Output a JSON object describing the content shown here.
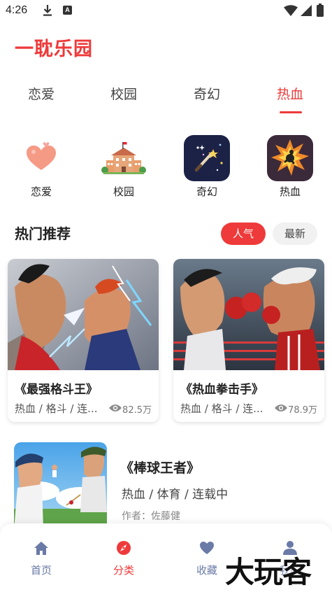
{
  "status_bar": {
    "time": "4:26",
    "notification_badge": "A"
  },
  "app": {
    "title": "一耽乐园"
  },
  "tabs": [
    {
      "label": "恋爱",
      "active": false
    },
    {
      "label": "校园",
      "active": false
    },
    {
      "label": "奇幻",
      "active": false
    },
    {
      "label": "热血",
      "active": true
    }
  ],
  "categories": [
    {
      "label": "恋爱",
      "icon": "heart-icon"
    },
    {
      "label": "校园",
      "icon": "school-icon"
    },
    {
      "label": "奇幻",
      "icon": "magic-wand-icon"
    },
    {
      "label": "热血",
      "icon": "explosion-icon"
    }
  ],
  "section": {
    "title": "热门推荐",
    "sort_options": [
      {
        "label": "人气",
        "active": true
      },
      {
        "label": "最新",
        "active": false
      }
    ]
  },
  "cards": [
    {
      "title": "《最强格斗王》",
      "tags": "热血 / 格斗 / 连...",
      "views": "82.5万"
    },
    {
      "title": "《热血拳击手》",
      "tags": "热血 / 格斗 / 连...",
      "views": "78.9万"
    }
  ],
  "list_items": [
    {
      "title": "《棒球王者》",
      "tags": "热血 / 体育 / 连载中",
      "author": "作者：佐藤健"
    }
  ],
  "bottom_nav": [
    {
      "label": "首页",
      "icon": "home-icon",
      "active": false
    },
    {
      "label": "分类",
      "icon": "compass-icon",
      "active": true
    },
    {
      "label": "收藏",
      "icon": "heart-icon",
      "active": false
    },
    {
      "label": "我的",
      "icon": "user-icon",
      "active": false
    }
  ],
  "watermark": {
    "text": "大玩客"
  },
  "colors": {
    "accent": "#ee3a3a",
    "nav_inactive": "#6a7aa6"
  }
}
